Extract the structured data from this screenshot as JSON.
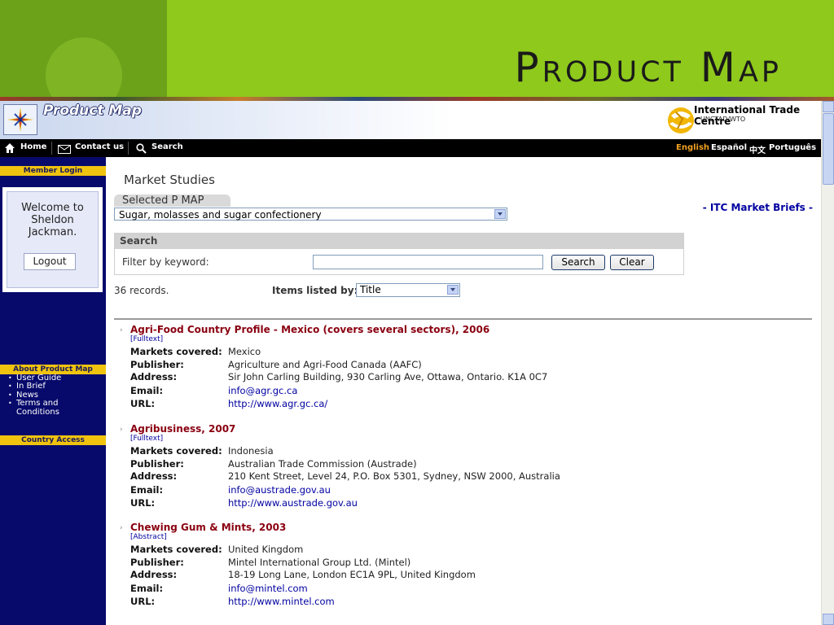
{
  "slide": {
    "title": "Product Map"
  },
  "banner": {
    "title": "Product Map",
    "itc_name": "International Trade Centre",
    "itc_sub": "UNCTAD/WTO"
  },
  "nav": {
    "home": "Home",
    "contact": "Contact us",
    "search": "Search",
    "languages": [
      "English",
      "Español",
      "中文",
      "Português"
    ]
  },
  "sidebar": {
    "member_login": "Member Login",
    "welcome": "Welcome to Sheldon Jackman.",
    "logout": "Logout",
    "about_header": "About Product Map",
    "about_items": [
      "User Guide",
      "In Brief",
      "News",
      "Terms and Conditions"
    ],
    "country_access": "Country Access"
  },
  "main": {
    "title": "Market Studies",
    "selected_tab": "Selected P MAP",
    "product_select": "Sugar, molasses and sugar confectionery",
    "briefs_link": "- ITC Market Briefs -",
    "search_heading": "Search",
    "filter_label": "Filter by keyword:",
    "keyword_value": "",
    "search_button": "Search",
    "clear_button": "Clear",
    "records": "36 records.",
    "items_listed_label": "Items listed by:",
    "sort_value": "Title",
    "field_labels": {
      "markets": "Markets covered:",
      "publisher": "Publisher:",
      "address": "Address:",
      "email": "Email:",
      "url": "URL:"
    },
    "items": [
      {
        "title": "Agri-Food Country Profile - Mexico (covers several sectors), 2006",
        "tag": "[Fulltext]",
        "markets": "Mexico",
        "publisher": "Agriculture and Agri-Food Canada (AAFC)",
        "address": "Sir John Carling Building, 930 Carling Ave, Ottawa, Ontario. K1A 0C7",
        "email": "info@agr.gc.ca",
        "url": "http://www.agr.gc.ca/"
      },
      {
        "title": "Agribusiness, 2007",
        "tag": "[Fulltext]",
        "markets": "Indonesia",
        "publisher": "Australian Trade Commission (Austrade)",
        "address": "210 Kent Street, Level 24, P.O. Box 5301, Sydney, NSW 2000, Australia",
        "email": "info@austrade.gov.au",
        "url": "http://www.austrade.gov.au"
      },
      {
        "title": "Chewing Gum & Mints, 2003",
        "tag": "[Abstract]",
        "markets": "United Kingdom",
        "publisher": "Mintel International Group Ltd. (Mintel)",
        "address": "18-19 Long Lane, London EC1A 9PL, United Kingdom",
        "email": "info@mintel.com",
        "url": "http://www.mintel.com"
      }
    ]
  }
}
